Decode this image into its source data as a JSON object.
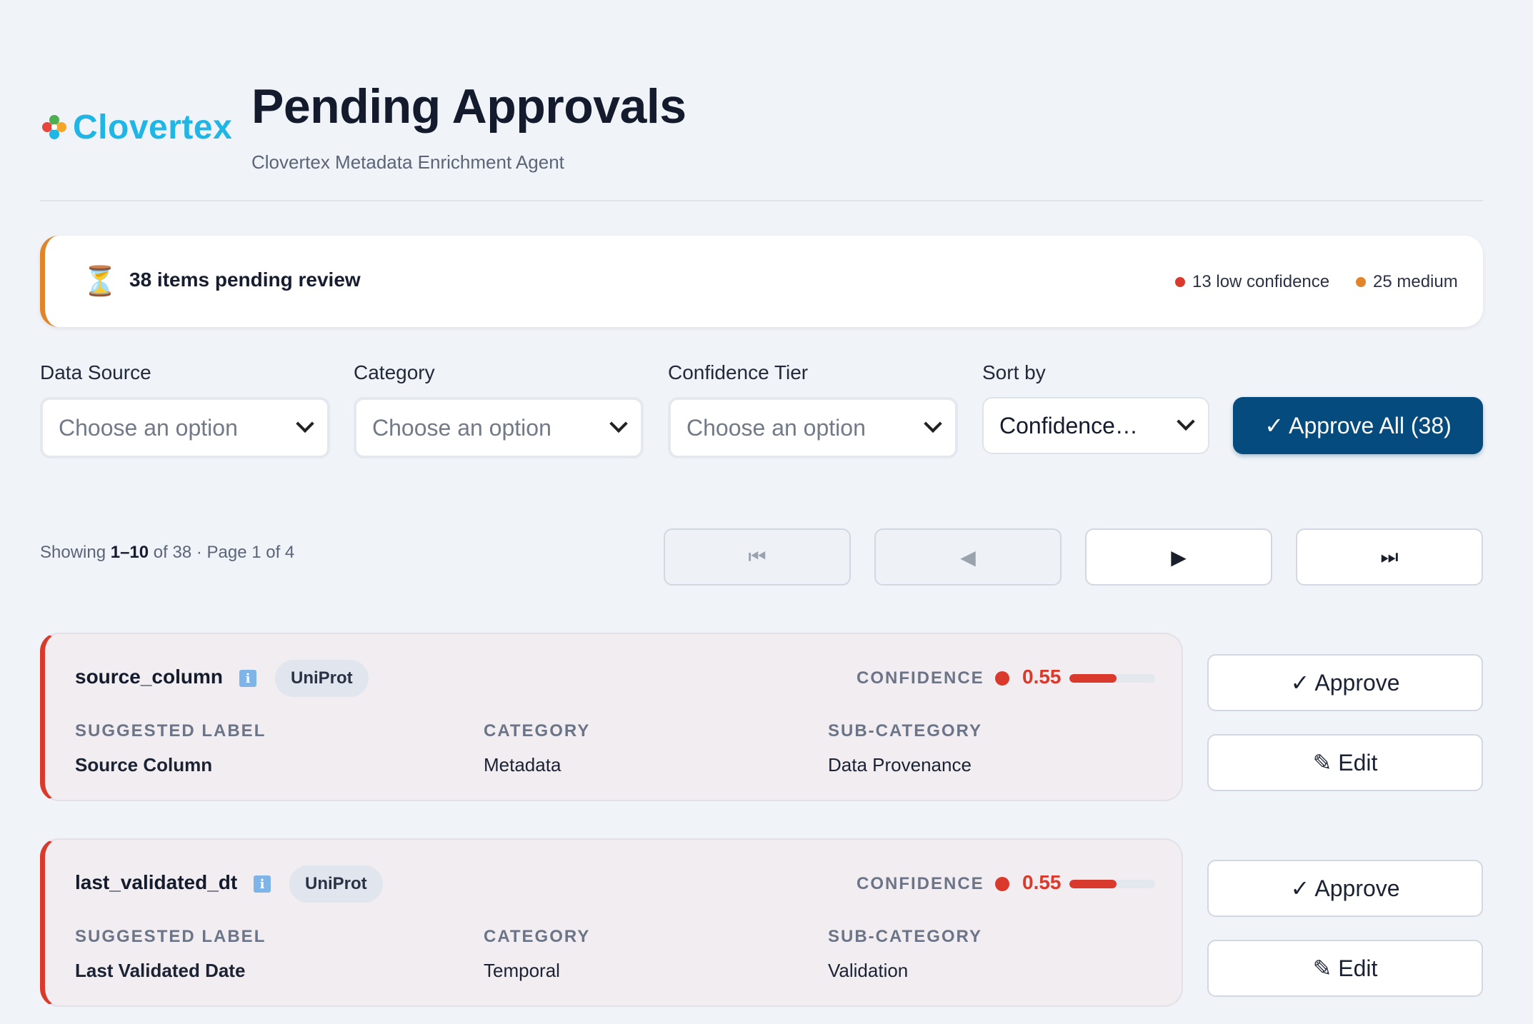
{
  "header": {
    "logo_text": "Clovertex",
    "title": "Pending Approvals",
    "subtitle": "Clovertex Metadata Enrichment Agent"
  },
  "banner": {
    "icon": "⏳",
    "text": "38 items pending review",
    "low_label": "13 low confidence",
    "medium_label": "25 medium",
    "low_color": "#d93a2c",
    "medium_color": "#e0852a"
  },
  "filters": {
    "data_source": {
      "label": "Data Source",
      "value": "Choose an option"
    },
    "category": {
      "label": "Category",
      "value": "Choose an option"
    },
    "confidence_tier": {
      "label": "Confidence Tier",
      "value": "Choose an option"
    },
    "sort_by": {
      "label": "Sort by",
      "value": "Confidence…"
    },
    "approve_all_label": "✓ Approve All (38)"
  },
  "pagination": {
    "showing_prefix": "Showing ",
    "range": "1–10",
    "suffix": " of 38 · Page 1 of 4",
    "first_icon": "⏮",
    "prev_icon": "◀",
    "next_icon": "▶",
    "last_icon": "⏭"
  },
  "columns": {
    "suggested_label": "SUGGESTED LABEL",
    "category": "CATEGORY",
    "sub_category": "SUB-CATEGORY",
    "confidence": "CONFIDENCE"
  },
  "items": [
    {
      "field_name": "source_column",
      "source": "UniProt",
      "confidence": "0.55",
      "confidence_value": 0.55,
      "suggested_label": "Source Column",
      "category": "Metadata",
      "sub_category": "Data Provenance",
      "approve_label": "✓ Approve",
      "edit_label": "✎ Edit"
    },
    {
      "field_name": "last_validated_dt",
      "source": "UniProt",
      "confidence": "0.55",
      "confidence_value": 0.55,
      "suggested_label": "Last Validated Date",
      "category": "Temporal",
      "sub_category": "Validation",
      "approve_label": "✓ Approve",
      "edit_label": "✎ Edit"
    }
  ]
}
